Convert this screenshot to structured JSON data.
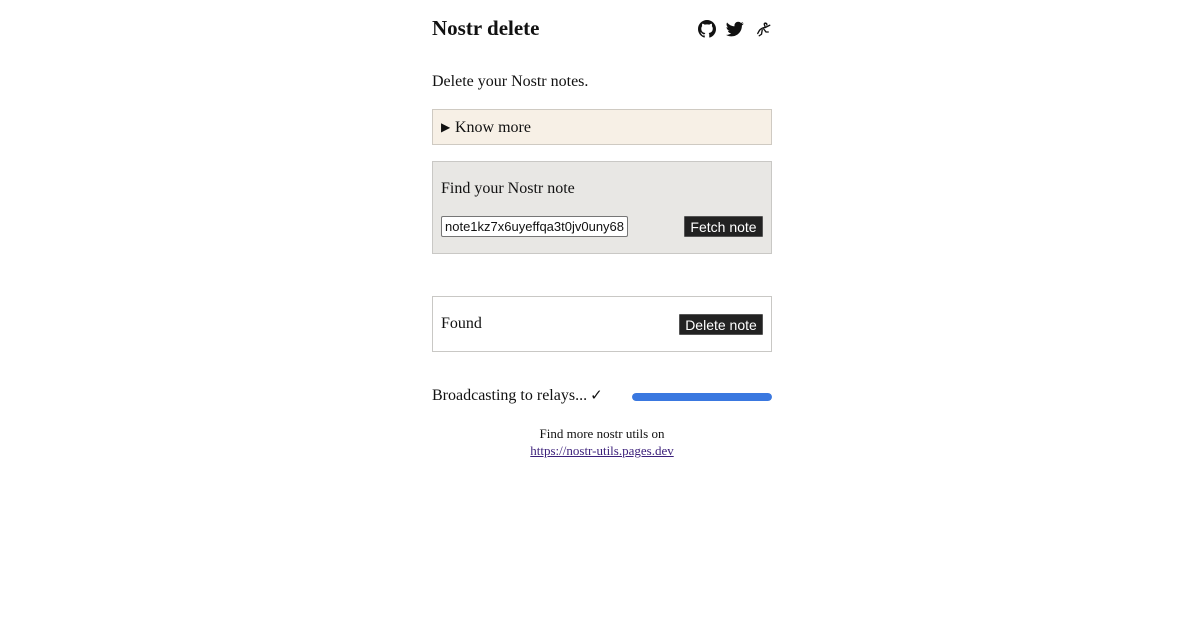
{
  "header": {
    "title": "Nostr delete",
    "icons": [
      "github-icon",
      "twitter-icon",
      "ostrich-icon"
    ]
  },
  "intro": "Delete your Nostr notes.",
  "know_more": {
    "marker": "▶",
    "label": "Know more"
  },
  "find": {
    "heading": "Find your Nostr note",
    "input_value": "note1kz7x6uyeffqa3t0jv0uny68",
    "fetch_label": "Fetch note"
  },
  "found": {
    "label": "Found",
    "delete_label": "Delete note"
  },
  "broadcast": {
    "text": "Broadcasting to relays...",
    "check": "✓",
    "progress": 1.0
  },
  "footer": {
    "text": "Find more nostr utils on",
    "link_text": "https://nostr-utils.pages.dev"
  },
  "colors": {
    "know_more_bg": "#f7f0e6",
    "find_bg": "#e8e7e4",
    "progress": "#3a78e0",
    "button_bg": "#222222",
    "link": "#3b1f7a"
  }
}
